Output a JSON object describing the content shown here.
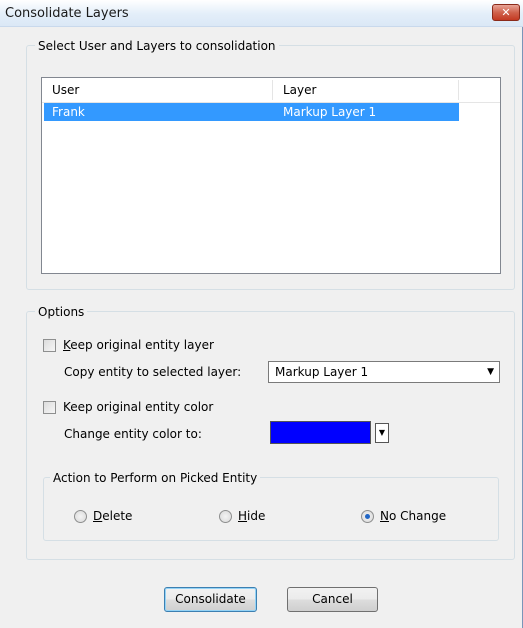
{
  "window": {
    "title": "Consolidate Layers",
    "close_glyph": "✕"
  },
  "select_group": {
    "legend": "Select User and Layers to consolidation",
    "columns": [
      "User",
      "Layer"
    ],
    "rows": [
      {
        "user": "Frank",
        "layer": "Markup Layer 1",
        "selected": true
      }
    ]
  },
  "options": {
    "legend": "Options",
    "keep_layer": {
      "label": "Keep original entity layer",
      "mnemonic": "K",
      "checked": false
    },
    "copy_label": "Copy entity to selected layer:",
    "layer_select": {
      "value": "Markup Layer 1"
    },
    "keep_color": {
      "label": "Keep original entity color",
      "checked": false
    },
    "change_color_label": "Change entity color to:",
    "entity_color": "#0000ff"
  },
  "action": {
    "legend": "Action to Perform on Picked Entity",
    "options": [
      {
        "label": "Delete",
        "mnemonic": "D",
        "checked": false
      },
      {
        "label": "Hide",
        "mnemonic": "H",
        "checked": false
      },
      {
        "label": "No Change",
        "mnemonic": "N",
        "checked": true
      }
    ]
  },
  "buttons": {
    "consolidate": "Consolidate",
    "cancel": "Cancel"
  },
  "colors": {
    "selection": "#3399ff",
    "radio_dot": "#2166c6"
  }
}
